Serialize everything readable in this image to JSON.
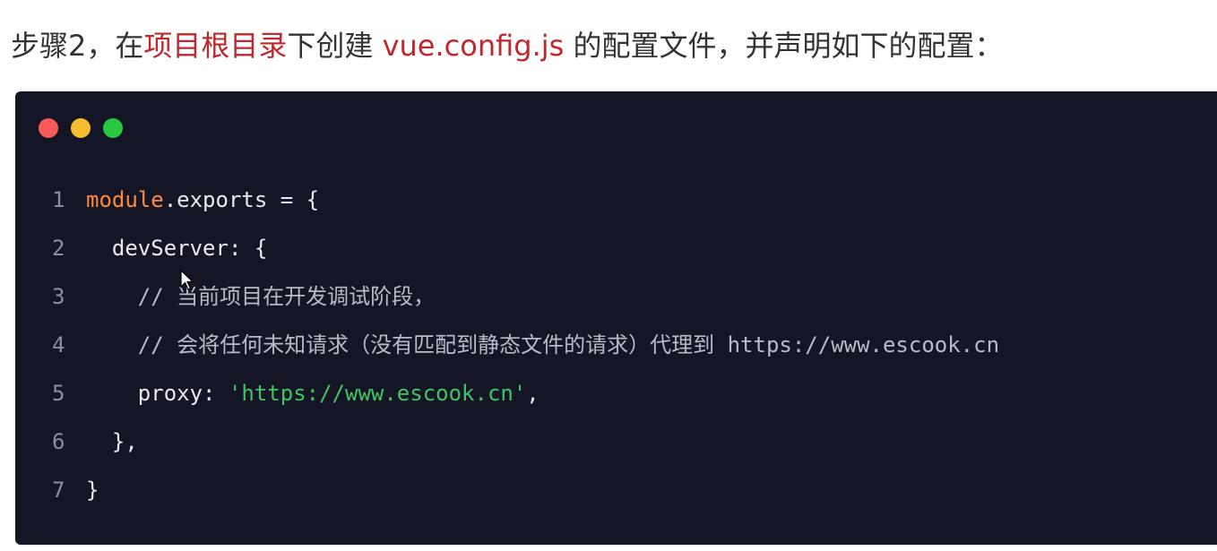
{
  "heading": {
    "part1": "步骤2，在",
    "part2_red": "项目根目录",
    "part3": "下创建 ",
    "part4_red": "vue.config.js",
    "part5": " 的配置文件，并声明如下的配置："
  },
  "colors": {
    "accent_red": "#c0282d",
    "code_bg": "#141625",
    "keyword": "#ff8a3d",
    "string": "#40c463",
    "comment": "#b8bac4"
  },
  "window_controls": [
    "red-dot",
    "yellow-dot",
    "green-dot"
  ],
  "code": {
    "lines": [
      {
        "num": "1",
        "indent": "",
        "kw": "module",
        "rest": ".exports = {"
      },
      {
        "num": "2",
        "indent": "  ",
        "text": "devServer: {"
      },
      {
        "num": "3",
        "indent": "    ",
        "comment": "// 当前项目在开发调试阶段，"
      },
      {
        "num": "4",
        "indent": "    ",
        "comment": "// 会将任何未知请求（没有匹配到静态文件的请求）代理到 ",
        "comment_url": "https://www.escook.cn"
      },
      {
        "num": "5",
        "indent": "    ",
        "key": "proxy: ",
        "string": "'https://www.escook.cn'",
        "after": ","
      },
      {
        "num": "6",
        "indent": "  ",
        "text": "},"
      },
      {
        "num": "7",
        "indent": "",
        "text": "}"
      }
    ]
  }
}
